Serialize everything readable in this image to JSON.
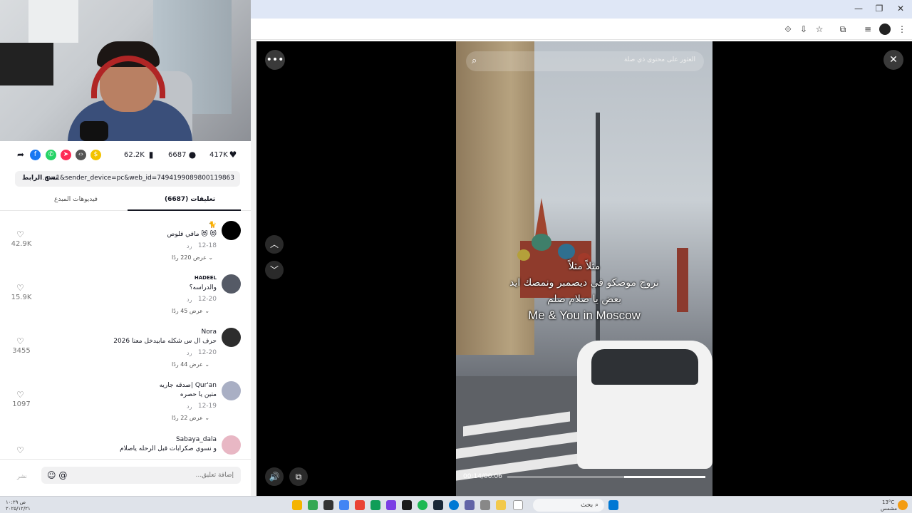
{
  "window": {
    "minimize": "—",
    "maximize": "❐",
    "close": "✕"
  },
  "toolbar": {
    "icons": [
      "translate-icon",
      "install-icon",
      "star-icon",
      "extensions-icon",
      "media-icon",
      "profile-icon",
      "menu-icon"
    ]
  },
  "post": {
    "stats": {
      "likes": "417K",
      "comments": "6687",
      "saves": "62.2K"
    },
    "share_icons": [
      "share-arrow-icon",
      "facebook-icon",
      "whatsapp-icon",
      "telegram-icon",
      "embed-icon",
      "coin-icon"
    ],
    "link_url": "...p=1&sender_device=pc&web_id=7494199089800119863",
    "copy_link_label": "نسخ الرابط",
    "tabs": {
      "comments": "(6687) تعليقات",
      "creator_videos": "فيديوهات المبدع"
    }
  },
  "comments": [
    {
      "user": "🐈",
      "text": "😻 😻 مافي فلوص",
      "date": "12-18",
      "reply": "رد",
      "view_replies": "عرض 220 ردًا ⌄",
      "likes": "42.9K",
      "avatar_color": "#000000"
    },
    {
      "user": "HADEEL",
      "text": "والدراسه؟",
      "date": "12-20",
      "reply": "رد",
      "view_replies": "عرض 45 ردًا ⌄",
      "likes": "15.9K",
      "avatar_color": "#555a66"
    },
    {
      "user": "Nora",
      "text": "حرف ال س شكله مابيدخل معنا 2026",
      "date": "12-20",
      "reply": "رد",
      "view_replies": "عرض 44 ردًا ⌄",
      "likes": "3455",
      "avatar_color": "#2d2d2d"
    },
    {
      "user": "صدقه جاريه| Qur'an",
      "text": "متين يا حصره",
      "date": "12-19",
      "reply": "رد",
      "view_replies": "عرض 22 ردًا ⌄",
      "likes": "1097",
      "avatar_color": "#a9afc4"
    },
    {
      "user": "Sabaya_dala",
      "text": "و نسوي صكرابات قبل الرحله ياصلام",
      "date": "",
      "reply": "",
      "view_replies": "",
      "likes": "",
      "avatar_color": "#e8b7c4"
    }
  ],
  "comment_box": {
    "placeholder": "إضافة تعليق...",
    "icons": "☺ @",
    "post_label": "نشر"
  },
  "video": {
    "search_placeholder": "العثور على محتوى ذي صلة",
    "caption_lines": [
      "مثلاً مثلاً",
      "نروح موصكو في ديصمبر ونمصك ايد",
      "بعض يا صلام صلم"
    ],
    "caption_en": "Me & You in Moscow",
    "time": "00:14/00:06",
    "progress": 0.41
  },
  "taskbar": {
    "search_label": "بحث",
    "weather": "13°C",
    "weather_desc": "مشمس",
    "clock": "۱۰:۲۹ ص",
    "date": "۲۰۲۵/۱۲/۲۱"
  }
}
